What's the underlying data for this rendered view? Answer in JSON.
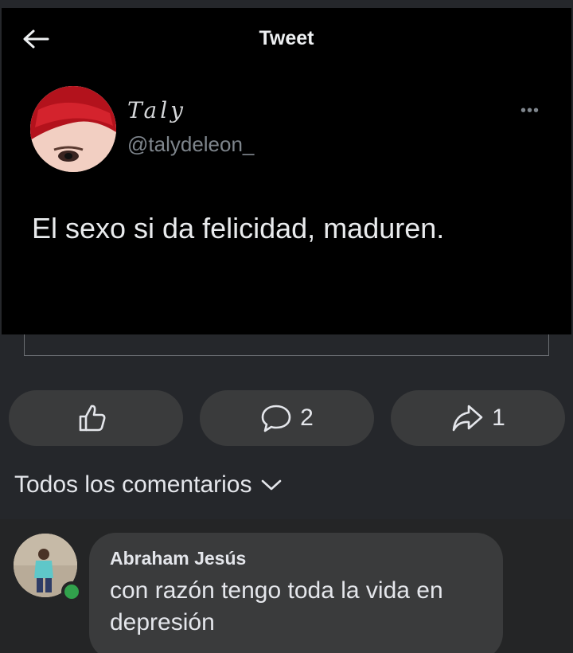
{
  "tweet": {
    "header_title": "Tweet",
    "author_name": "Taly",
    "author_handle": "@talydeleon_",
    "more_label": "•••",
    "text": "El sexo si da felicidad, maduren."
  },
  "actions": {
    "like_count": "",
    "comment_count": "2",
    "share_count": "1"
  },
  "comments_filter": {
    "label": "Todos los comentarios"
  },
  "comment": {
    "author": "Abraham Jesús",
    "text": "con razón tengo toda la vida en depresión"
  },
  "colors": {
    "background": "#25272b",
    "tweet_background": "#000000",
    "pill": "#3a3b3c",
    "online": "#31a24c"
  }
}
